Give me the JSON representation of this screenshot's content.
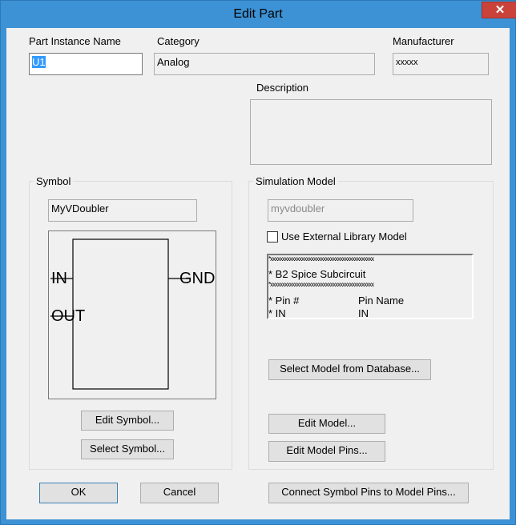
{
  "window": {
    "title": "Edit Part",
    "close_glyph": "✕"
  },
  "fields": {
    "part_instance_name": {
      "label": "Part Instance Name",
      "value": "U1"
    },
    "category": {
      "label": "Category",
      "value": "Analog"
    },
    "manufacturer": {
      "label": "Manufacturer",
      "value": "xxxxx"
    },
    "description": {
      "label": "Description",
      "value": ""
    }
  },
  "symbol": {
    "group_label": "Symbol",
    "name": "MyVDoubler",
    "pins": {
      "in": "IN",
      "out": "OUT",
      "gnd": "GND"
    },
    "edit_button": "Edit Symbol...",
    "select_button": "Select Symbol..."
  },
  "simulation_model": {
    "group_label": "Simulation Model",
    "name": "myvdoubler",
    "use_external_label": "Use External Library Model",
    "use_external_checked": false,
    "listing": {
      "line1": "*xxxxxxxxxxxxxxxxxxxxxxxxxxxxxxxxxxxxxxxxxxx",
      "line2": "* B2 Spice Subcircuit",
      "line3": "*xxxxxxxxxxxxxxxxxxxxxxxxxxxxxxxxxxxxxxxxxxx",
      "row1_a": "* Pin #",
      "row1_b": "Pin Name",
      "row2_a": "* IN",
      "row2_b": "IN"
    },
    "select_db_button": "Select Model from Database...",
    "edit_model_button": "Edit Model...",
    "edit_model_pins_button": "Edit Model Pins..."
  },
  "footer": {
    "ok": "OK",
    "cancel": "Cancel",
    "connect": "Connect Symbol Pins to Model Pins..."
  }
}
